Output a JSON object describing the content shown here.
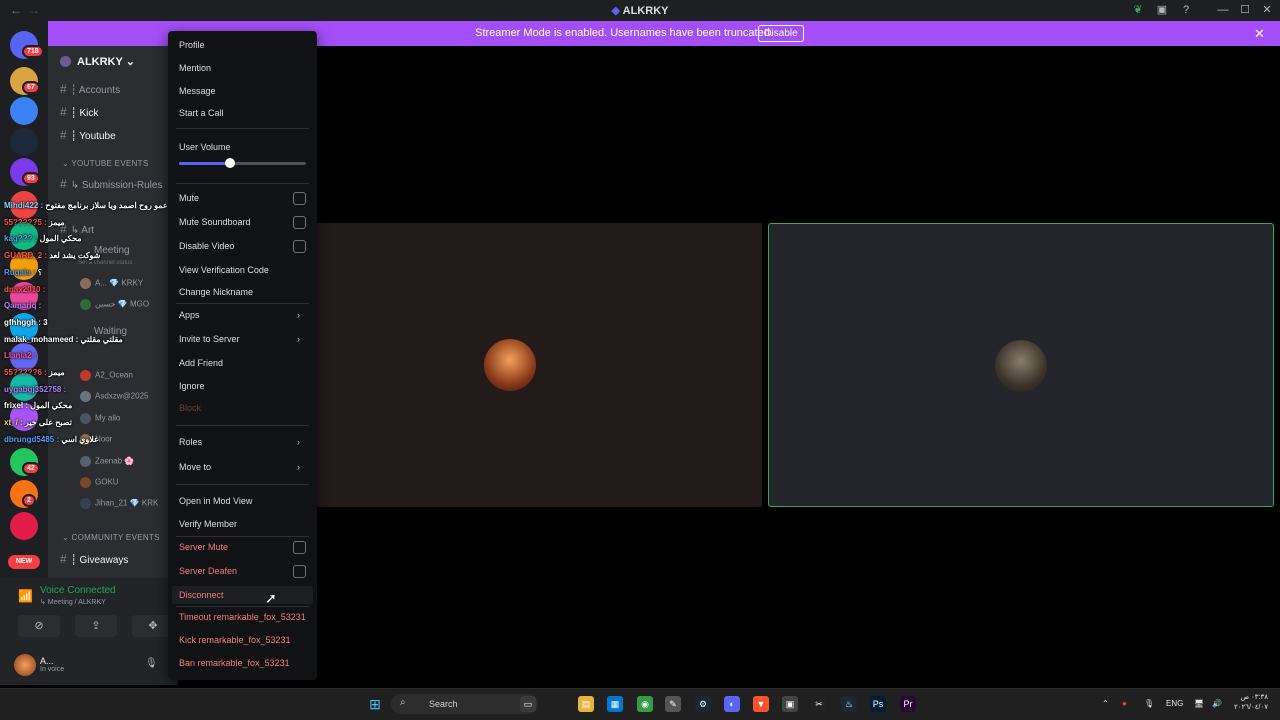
{
  "window": {
    "title": "ALKRKY",
    "back": "←",
    "forward": "→"
  },
  "banner": {
    "text": "Streamer Mode is enabled. Usernames have been truncated.",
    "button": "Disable",
    "close": "✕"
  },
  "rail": {
    "badges": [
      "718",
      "67",
      "93",
      "2",
      "42",
      "2"
    ],
    "new_label": "NEW",
    "server_colors": [
      "#5865f2",
      "#d9a441",
      "#3b82f6",
      "#1e293b",
      "#7c3aed",
      "#ef4444",
      "#10b981",
      "#f59e0b",
      "#ec4899",
      "#0ea5e9",
      "#6366f1",
      "#14b8a6",
      "#a855f7",
      "#22c55e",
      "#f97316",
      "#e11d48"
    ]
  },
  "server": {
    "name": "ALKRKY",
    "channels_top": [
      {
        "label": "┆ Accounts",
        "active": false
      },
      {
        "label": "┆ Kick",
        "active": true
      },
      {
        "label": "┆ Youtube",
        "active": true
      }
    ],
    "category_youtube": "YOUTUBE EVENTS",
    "submission": "↳ Submission-Rules",
    "art": "↳ Art",
    "meeting": "Meeting",
    "channel_status": "Set a channel status",
    "waiting": "Waiting",
    "category_community": "COMMUNITY EVENTS",
    "giveaways": "┆ Giveaways"
  },
  "voice_users": [
    {
      "name": "A... 💎 KRKY"
    },
    {
      "name": "حسين 💎 MGO"
    },
    {
      "name": "A2_Ocean"
    },
    {
      "name": "Asdxzw@2025"
    },
    {
      "name": "My allo"
    },
    {
      "name": "Noor"
    },
    {
      "name": "Zaenab 🌸"
    },
    {
      "name": "GOKU"
    },
    {
      "name": "Jihan_21 💎 KRK"
    }
  ],
  "chat_overlay": [
    {
      "user": "Mihdi422",
      "msg": "عمو روح اصمد ويا سلاز برنامج مفتوح",
      "color": "#7fd3ff"
    },
    {
      "user": "55?????5",
      "msg": "ميمز",
      "color": "#ff4d4d"
    },
    {
      "user": "kag???",
      "msg": "محكي المول",
      "color": "#4d9bff"
    },
    {
      "user": "GUARD_2",
      "msg": "شوكت يشد لعد",
      "color": "#ff4d4d"
    },
    {
      "user": "Ruqaia",
      "msg": "؟",
      "color": "#4d9bff"
    },
    {
      "user": "dnax2010",
      "msg": "",
      "color": "#ff4d4d"
    },
    {
      "user": "Qamariq",
      "msg": "",
      "color": "#b57bff"
    },
    {
      "user": "gfhhggh",
      "msg": "3",
      "color": "#ffffff"
    },
    {
      "user": "malak_mohameed",
      "msg": "مقلتي مقلتي",
      "color": "#ffffff"
    },
    {
      "user": "Llania2",
      "msg": "",
      "color": "#ff4d8d"
    },
    {
      "user": "55?????6",
      "msg": "ميمز",
      "color": "#ff4d4d"
    },
    {
      "user": "uygabgj352758",
      "msg": "",
      "color": "#b57bff"
    },
    {
      "user": "frixel",
      "msg": "محكي المول",
      "color": "#ffffff"
    },
    {
      "user": "xt_/",
      "msg": "تصبح على خير",
      "color": "#ffcc66"
    },
    {
      "user": "dbrungd5485",
      "msg": "علاوي اسي",
      "color": "#4d9bff"
    }
  ],
  "voice_panel": {
    "status": "Voice Connected",
    "channel": "↳ Meeting / ALKRKY",
    "user": "A...",
    "user_status": "In voice"
  },
  "context_menu": {
    "profile": "Profile",
    "mention": "Mention",
    "message": "Message",
    "start_call": "Start a Call",
    "user_volume": "User Volume",
    "volume_fraction": 0.4,
    "mute": "Mute",
    "mute_soundboard": "Mute Soundboard",
    "disable_video": "Disable Video",
    "view_verification": "View Verification Code",
    "change_nickname": "Change Nickname",
    "apps": "Apps",
    "invite": "Invite to Server",
    "add_friend": "Add Friend",
    "ignore": "Ignore",
    "block": "Block",
    "roles": "Roles",
    "move_to": "Move to",
    "mod_view": "Open in Mod View",
    "verify_member": "Verify Member",
    "server_mute": "Server Mute",
    "server_deafen": "Server Deafen",
    "disconnect": "Disconnect",
    "timeout": "Timeout remarkable_fox_53231",
    "kick": "Kick remarkable_fox_53231",
    "ban": "Ban remarkable_fox_53231"
  },
  "taskbar": {
    "search": "Search",
    "lang": "ENG",
    "time": "٠٣:٣٨ ص",
    "date": "٢٠٢٦/٠٤/٠٧"
  }
}
